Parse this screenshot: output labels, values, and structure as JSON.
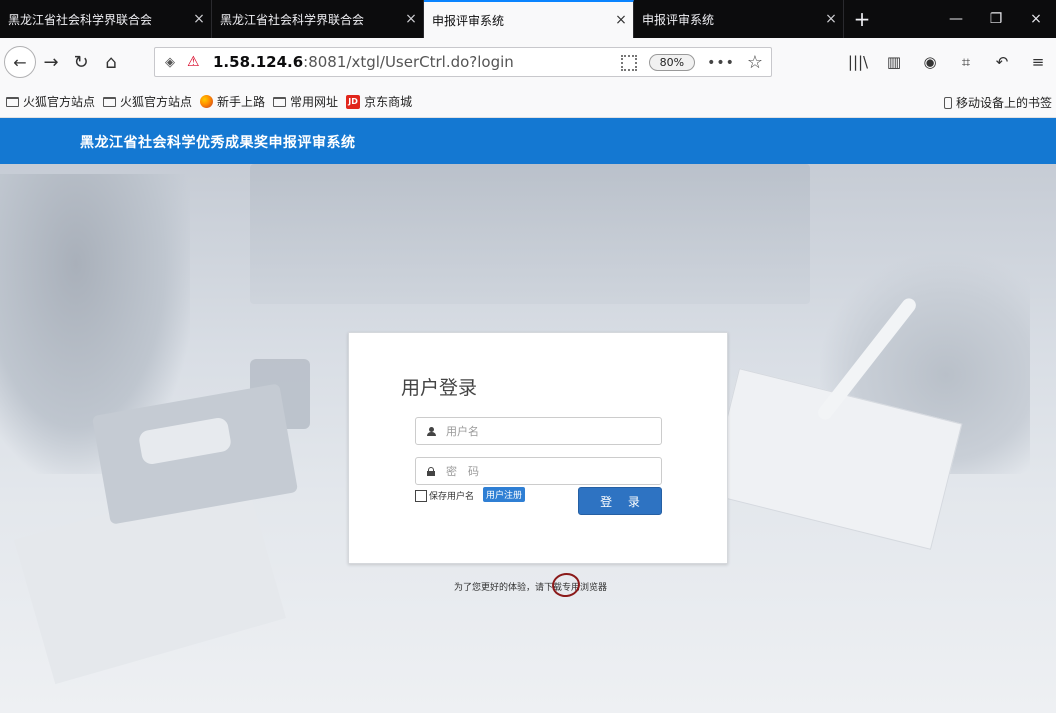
{
  "tabs": [
    {
      "title": "黑龙江省社会科学界联合会",
      "close": "×"
    },
    {
      "title": "黑龙江省社会科学界联合会",
      "close": "×"
    },
    {
      "title": "申报评审系统",
      "close": "×"
    },
    {
      "title": "申报评审系统",
      "close": "×"
    }
  ],
  "new_tab": "+",
  "window": {
    "minimize": "—",
    "restore": "❐",
    "close": "×"
  },
  "nav": {
    "back": "←",
    "forward": "→",
    "reload": "↻",
    "home": "⌂",
    "url_host": "1.58.124.6",
    "url_rest": ":8081/xtgl/UserCtrl.do?login",
    "zoom": "80%",
    "more": "•••",
    "star": "☆",
    "library": "|||\\",
    "sidebar": "▥",
    "extension": "◉",
    "crop": "⌗",
    "undo": "↶",
    "menu": "≡"
  },
  "bookmarks": {
    "items": [
      "火狐官方站点",
      "火狐官方站点",
      "新手上路",
      "常用网址",
      "京东商城"
    ],
    "jd_badge": "JD",
    "mobile": "移动设备上的书签"
  },
  "site": {
    "title": "黑龙江省社会科学优秀成果奖申报评审系统"
  },
  "login": {
    "title": "用户登录",
    "username_placeholder": "用户名",
    "password_placeholder": "密　码",
    "remember": "保存用户名",
    "register": "用户注册",
    "submit": "登 录"
  },
  "hint": "为了您更好的体验，请下载专用浏览器",
  "colors": {
    "header": "#1478d2",
    "button": "#2e73c2",
    "annotation": "#8b1a1a"
  }
}
